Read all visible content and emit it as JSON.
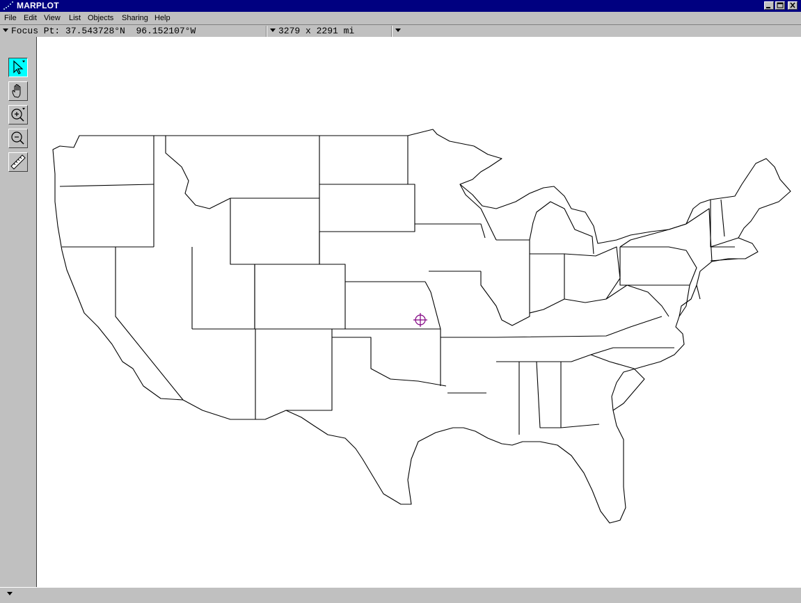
{
  "window": {
    "title": "MARPLOT",
    "minimize_icon": "minimize-icon",
    "maximize_icon": "maximize-icon",
    "close_icon": "close-icon"
  },
  "menu": [
    {
      "label": "File"
    },
    {
      "label": "Edit"
    },
    {
      "label": "View"
    },
    {
      "label": "List"
    },
    {
      "label": "Objects"
    },
    {
      "label": "Sharing"
    },
    {
      "label": "Help"
    }
  ],
  "coords": {
    "focus_label": "Focus Pt:",
    "latitude": "37.543728°N",
    "longitude": "96.152107°W",
    "extent": "3279 x 2291 mi"
  },
  "tools": [
    {
      "name": "arrow-tool",
      "icon": "arrow-pointer-icon",
      "active": true
    },
    {
      "name": "hand-tool",
      "icon": "hand-icon",
      "active": false
    },
    {
      "name": "zoom-in-tool",
      "icon": "zoom-in-icon",
      "active": false
    },
    {
      "name": "zoom-out-tool",
      "icon": "zoom-out-icon",
      "active": false
    },
    {
      "name": "ruler-tool",
      "icon": "ruler-icon",
      "active": false
    }
  ],
  "map": {
    "region": "Contiguous United States state boundaries",
    "marker": "crosshair-focus-icon",
    "marker_color": "#800080"
  },
  "colors": {
    "titlebar": "#000080",
    "active_tool": "#00ffff",
    "chrome": "#c0c0c0"
  }
}
